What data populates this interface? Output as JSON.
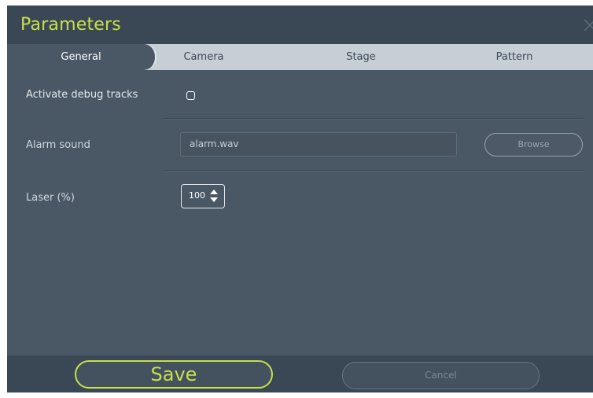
{
  "dialog": {
    "title": "Parameters",
    "close_icon": "close-icon"
  },
  "tabs": [
    {
      "label": "General",
      "active": true
    },
    {
      "label": "Camera",
      "active": false
    },
    {
      "label": "Stage",
      "active": false
    },
    {
      "label": "Pattern",
      "active": false
    }
  ],
  "general": {
    "debug_tracks_label": "Activate debug tracks",
    "debug_tracks_checked": false,
    "alarm_sound_label": "Alarm sound",
    "alarm_sound_value": "alarm.wav",
    "browse_label": "Browse",
    "laser_label": "Laser (%)",
    "laser_value": "100",
    "spin_icon": "spin-arrows-icon"
  },
  "footer": {
    "save_label": "Save",
    "cancel_label": "Cancel"
  },
  "colors": {
    "accent": "#c7e04a",
    "background": "#4a5866",
    "header": "#3a4856",
    "tab_bar": "#c6cfd6"
  }
}
